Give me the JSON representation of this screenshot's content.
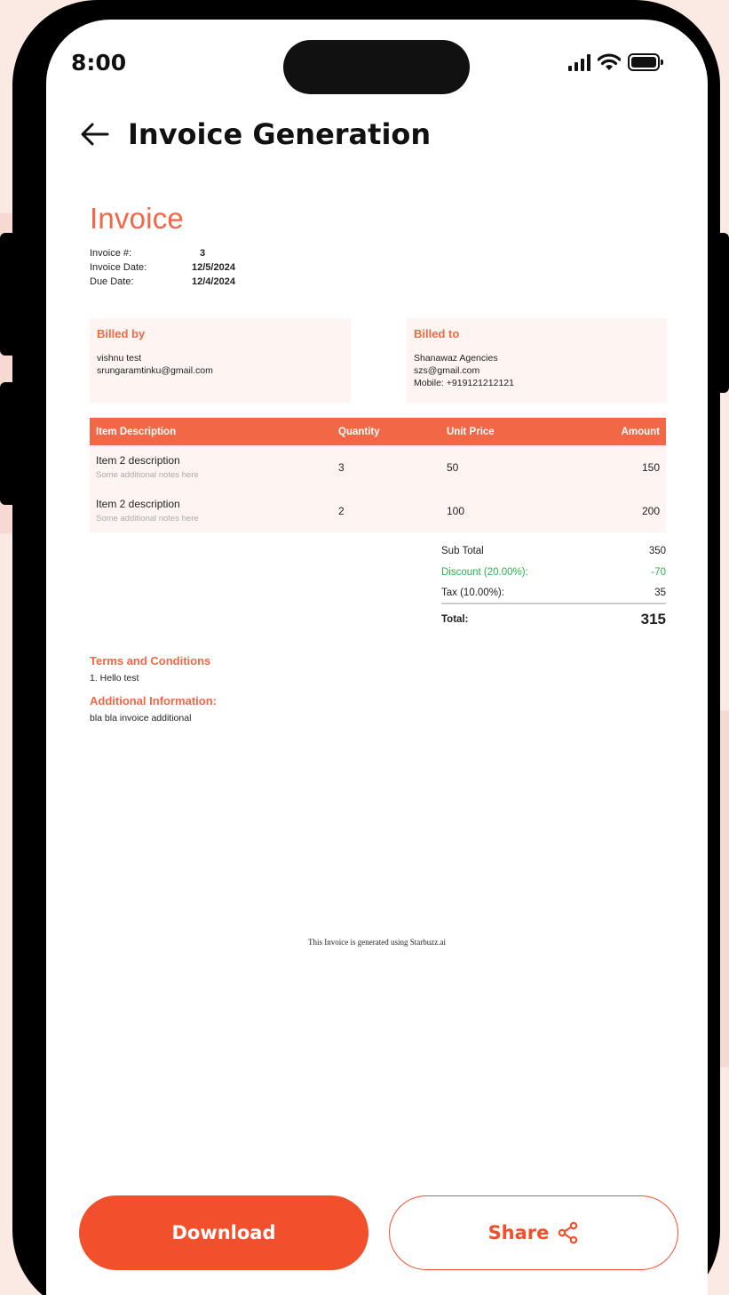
{
  "status_bar": {
    "time": "8:00"
  },
  "header": {
    "title": "Invoice Generation"
  },
  "invoice": {
    "title": "Invoice",
    "meta": [
      {
        "label": "Invoice #:",
        "value": "3"
      },
      {
        "label": "Invoice Date:",
        "value": "12/5/2024"
      },
      {
        "label": "Due Date:",
        "value": "12/4/2024"
      }
    ],
    "billed_by": {
      "heading": "Billed by",
      "name": "vishnu test",
      "email": "srungaramtinku@gmail.com"
    },
    "billed_to": {
      "heading": "Billed to",
      "name": "Shanawaz Agencies",
      "email": "szs@gmail.com",
      "mobile": "Mobile: +919121212121"
    },
    "table": {
      "headers": {
        "description": "Item Description",
        "quantity": "Quantity",
        "unit_price": "Unit Price",
        "amount": "Amount"
      },
      "rows": [
        {
          "description": "Item 2 description",
          "note": "Some additional notes here",
          "quantity": "3",
          "unit_price": "50",
          "amount": "150"
        },
        {
          "description": "Item 2 description",
          "note": "Some additional notes here",
          "quantity": "2",
          "unit_price": "100",
          "amount": "200"
        }
      ]
    },
    "totals": {
      "subtotal_label": "Sub Total",
      "subtotal_value": "350",
      "discount_label": "Discount (20.00%):",
      "discount_value": "-70",
      "tax_label": "Tax (10.00%):",
      "tax_value": "35",
      "total_label": "Total:",
      "total_value": "315"
    },
    "terms_heading": "Terms and Conditions",
    "terms_text": "1. Hello test",
    "additional_heading": "Additional Information:",
    "additional_text": "bla bla invoice additional",
    "footer_note": "This Invoice is generated using Starbuzz.ai"
  },
  "actions": {
    "download_label": "Download",
    "share_label": "Share"
  },
  "colors": {
    "accent": "#f26846",
    "button": "#f2502d",
    "discount": "#2bb24c"
  }
}
